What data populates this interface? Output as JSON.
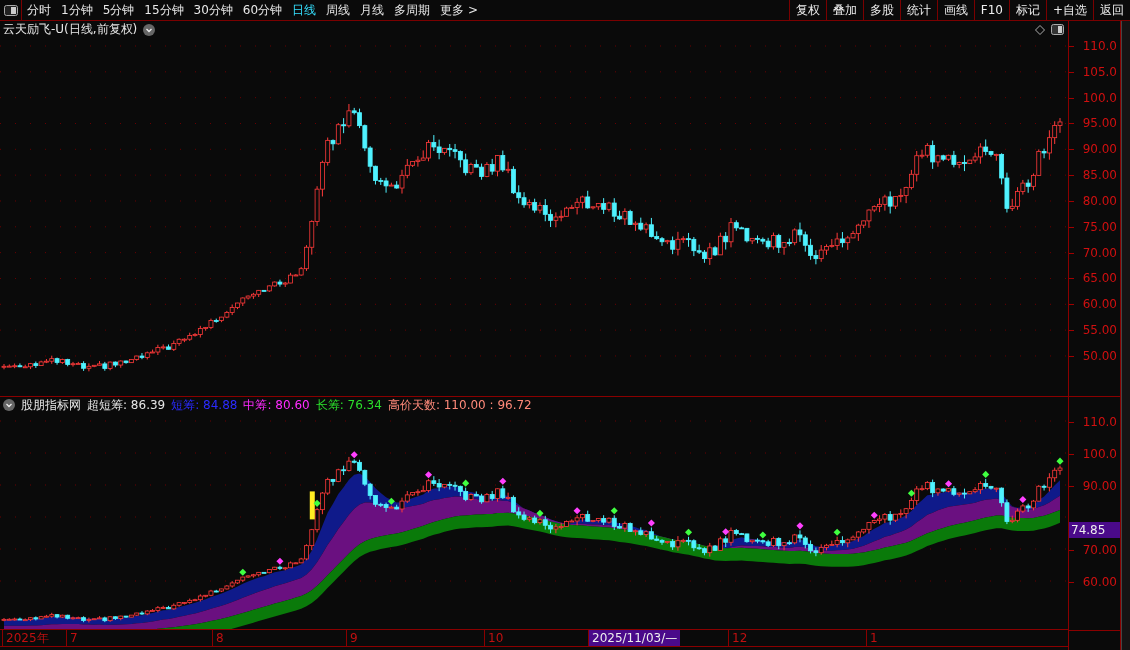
{
  "toolbar": {
    "tabs": [
      {
        "label": "分时",
        "selected": false
      },
      {
        "label": "1分钟",
        "selected": false
      },
      {
        "label": "5分钟",
        "selected": false
      },
      {
        "label": "15分钟",
        "selected": false
      },
      {
        "label": "30分钟",
        "selected": false
      },
      {
        "label": "60分钟",
        "selected": false
      },
      {
        "label": "日线",
        "selected": true
      },
      {
        "label": "周线",
        "selected": false
      },
      {
        "label": "月线",
        "selected": false
      },
      {
        "label": "多周期",
        "selected": false
      },
      {
        "label": "更多 >",
        "selected": false
      }
    ],
    "buttons": [
      "复权",
      "叠加",
      "多股",
      "统计",
      "画线",
      "F10",
      "标记",
      "+自选",
      "返回"
    ]
  },
  "chart_title": "云天励飞-U(日线,前复权)",
  "price_axis": [
    "110.0",
    "105.0",
    "100.0",
    "95.00",
    "90.00",
    "85.00",
    "80.00",
    "75.00",
    "70.00",
    "65.00",
    "60.00",
    "55.00",
    "50.00"
  ],
  "indicator": {
    "name": "股朋指标网",
    "values": [
      {
        "label": "超短筹: 86.39",
        "color": "#e6e6e6"
      },
      {
        "label": "短筹: 84.88",
        "color": "#2b2bff"
      },
      {
        "label": "中筹: 80.60",
        "color": "#ff2bff"
      },
      {
        "label": "长筹: 76.34",
        "color": "#2bdf2b"
      },
      {
        "label": "高价天数: 110.00 : 96.72",
        "color": "#ff8a7a"
      }
    ],
    "axis": [
      "110.0",
      "100.0",
      "90.00",
      "70.00",
      "60.00"
    ],
    "current_value": "74.85"
  },
  "time_axis": [
    {
      "label": "2025年",
      "kind": "year"
    },
    {
      "label": "7",
      "kind": "month"
    },
    {
      "label": "8",
      "kind": "month"
    },
    {
      "label": "9",
      "kind": "month"
    },
    {
      "label": "10",
      "kind": "month"
    },
    {
      "label": "2025/11/03/—",
      "kind": "cursor"
    },
    {
      "label": "12",
      "kind": "month"
    },
    {
      "label": "1",
      "kind": "month"
    }
  ]
}
